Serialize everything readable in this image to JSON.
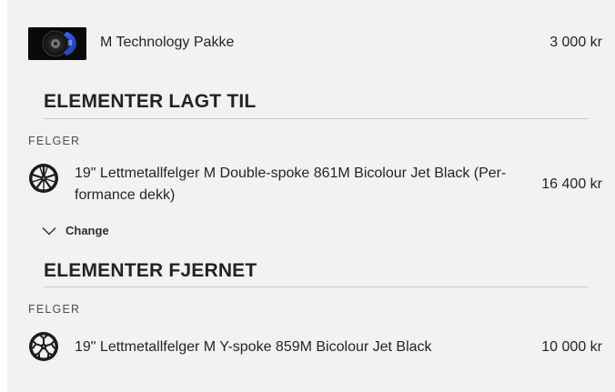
{
  "top_item": {
    "title": "M Technology Pakke",
    "price": "3 000 kr",
    "thumb_icon": "brake-caliper-image"
  },
  "added_section": {
    "heading": "ELEMENTER LAGT TIL",
    "category": "FELGER",
    "item": {
      "title_line1": "19\" Lettmetallfelger M Double-spoke 861M Bicolour Jet Black (Per-",
      "title_line2": "formance dekk)",
      "price": "16 400 kr",
      "icon": "wheel-rim-icon"
    },
    "change_label": "Change",
    "change_icon": "chevron-down-icon"
  },
  "removed_section": {
    "heading": "ELEMENTER FJERNET",
    "category": "FELGER",
    "item": {
      "title": "19\" Lettmetallfelger M Y-spoke 859M Bicolour Jet Black",
      "price": "10 000 kr",
      "icon": "wheel-rim-icon"
    }
  },
  "colors": {
    "panel_bg": "#f2f2f2",
    "text": "#1f2328",
    "divider": "#c8c8c8",
    "brake_blue": "#1f4fd8"
  }
}
